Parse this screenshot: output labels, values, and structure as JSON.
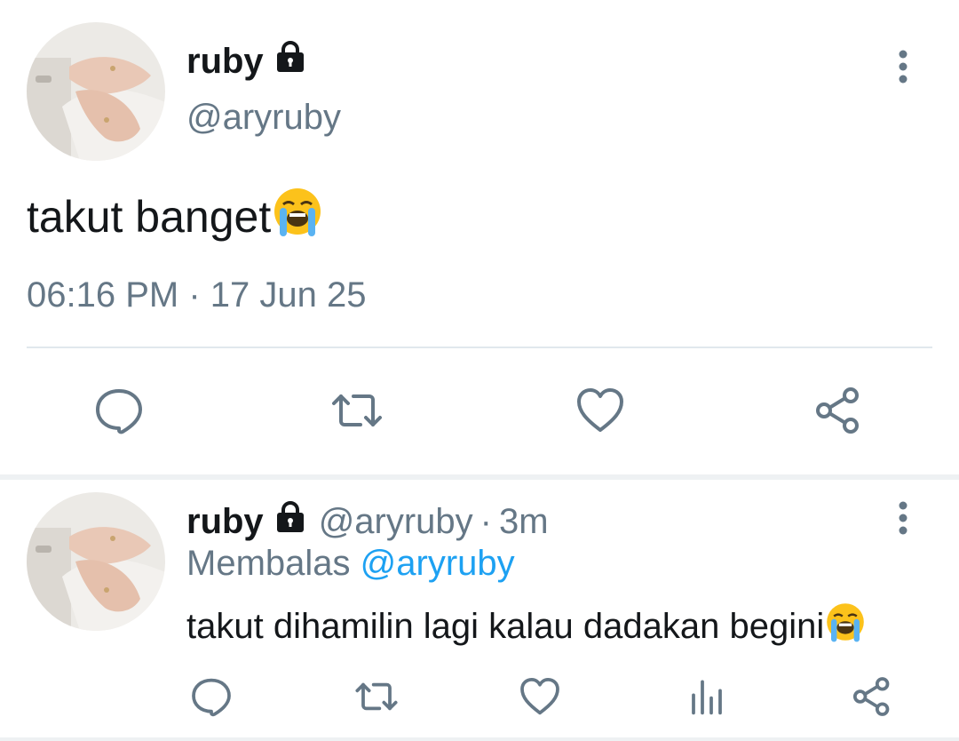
{
  "main_tweet": {
    "display_name": "ruby",
    "handle": "@aryruby",
    "text": "takut banget",
    "emoji": "loudly-crying-face",
    "timestamp": "06:16 PM · 17 Jun 25",
    "actions": [
      "reply-icon",
      "retweet-icon",
      "like-icon",
      "share-icon"
    ]
  },
  "reply_tweet": {
    "display_name": "ruby",
    "handle": "@aryruby",
    "separator": "·",
    "time_ago": "3m",
    "replying_prefix": "Membalas",
    "replying_to": "@aryruby",
    "text": "takut dihamilin lagi kalau dadakan begini",
    "emoji": "loudly-crying-face",
    "actions": [
      "reply-icon",
      "retweet-icon",
      "like-icon",
      "stats-icon",
      "share-icon"
    ]
  },
  "colors": {
    "text_primary": "#14171a",
    "text_secondary": "#657786",
    "link": "#1da1f2",
    "divider": "#e1e8ed"
  }
}
